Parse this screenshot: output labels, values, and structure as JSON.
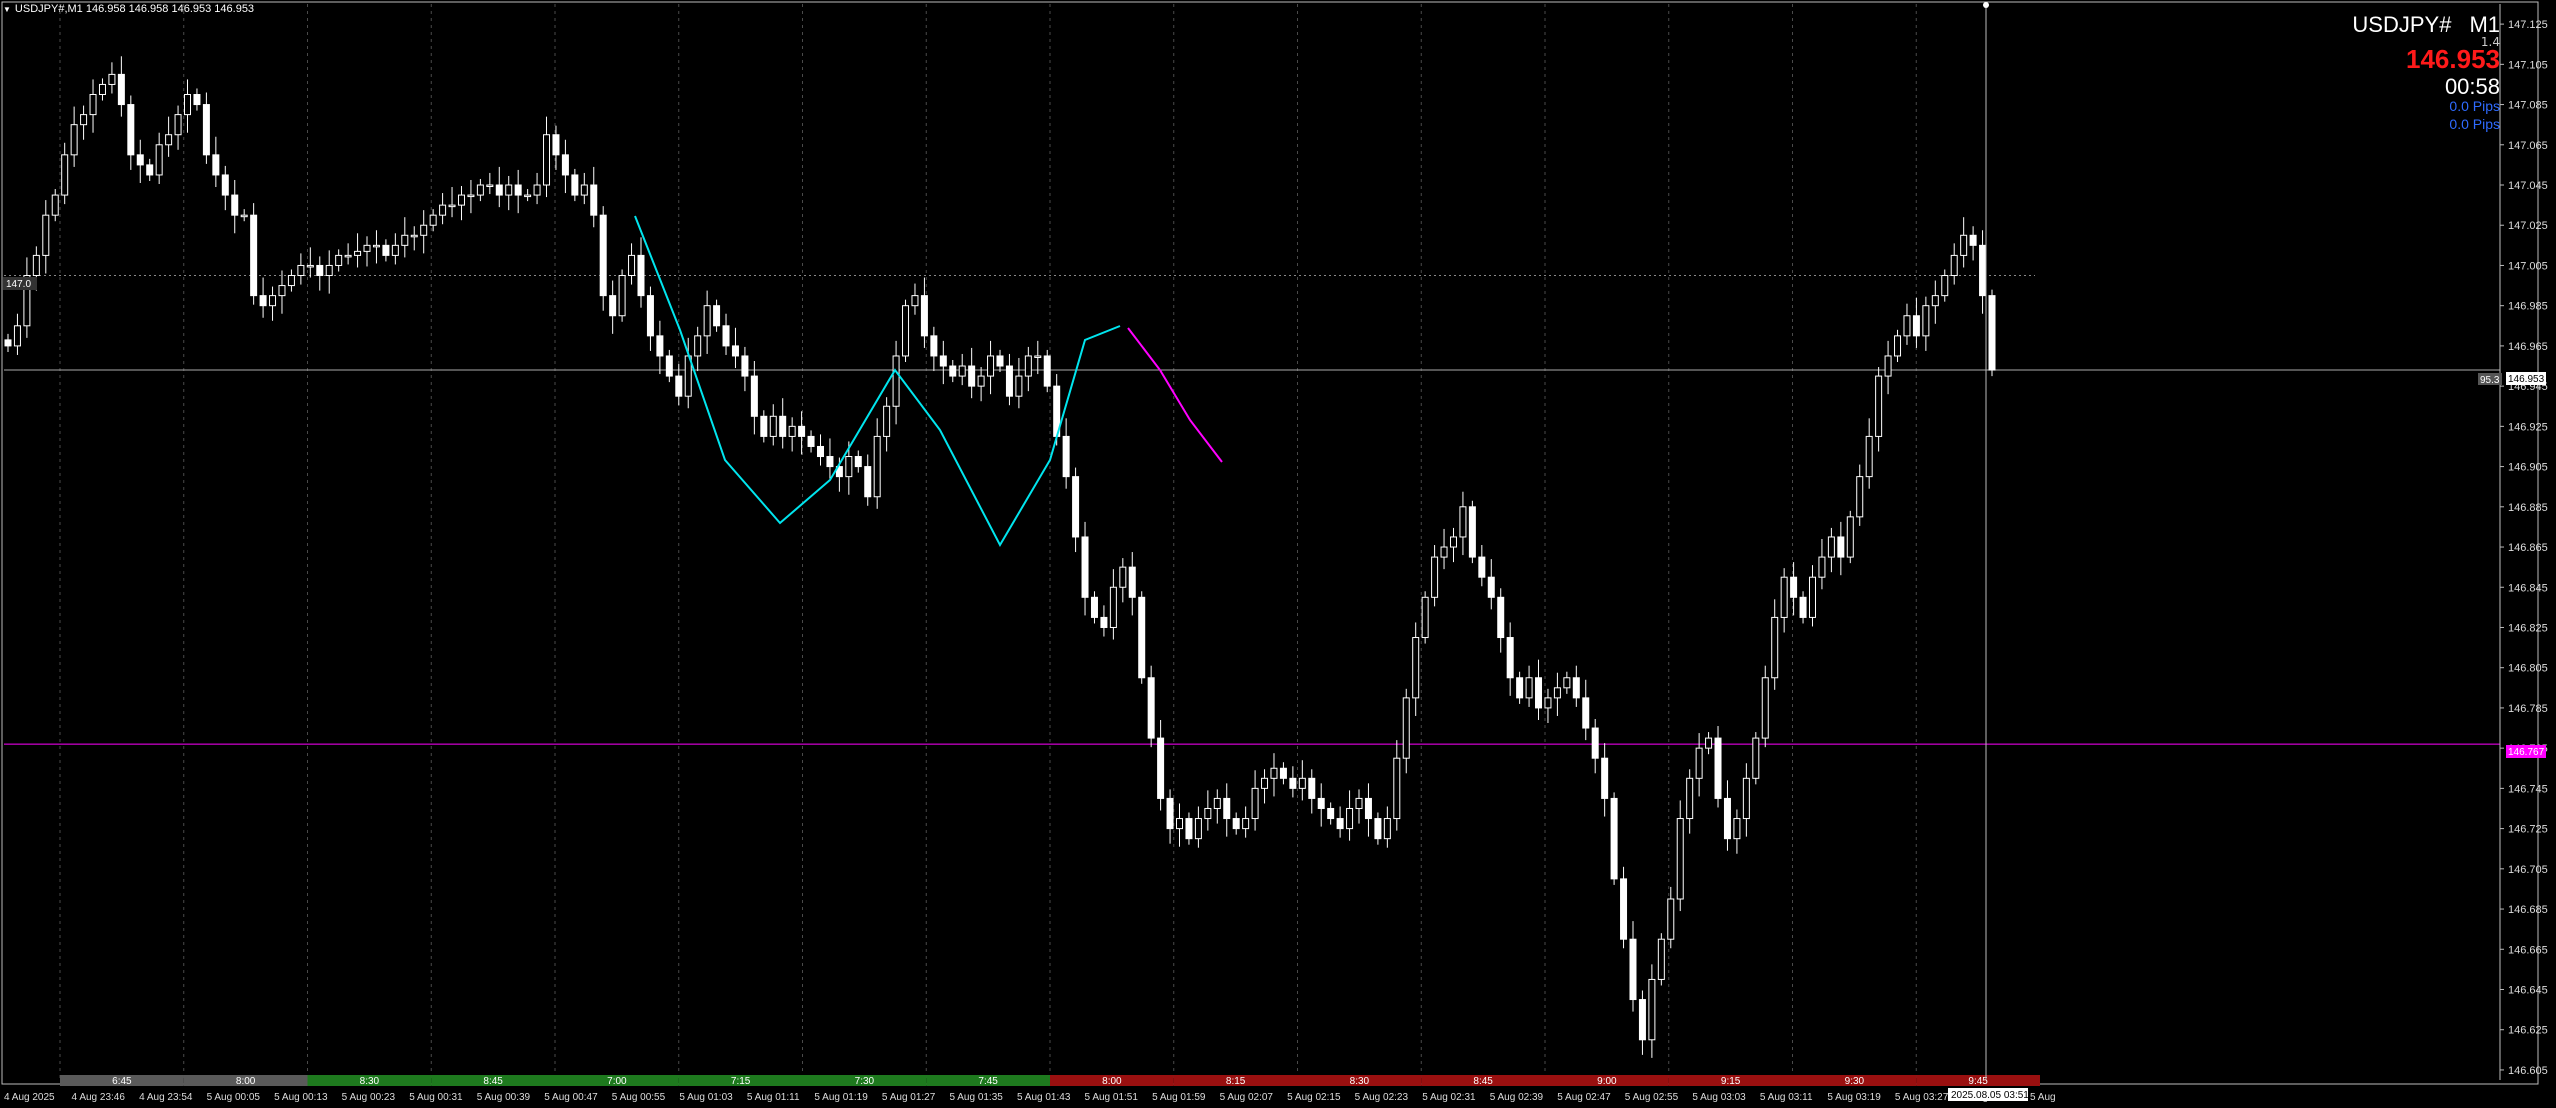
{
  "header": {
    "title": "USDJPY#,M1  146.958 146.958 146.953 146.953"
  },
  "hud": {
    "symbol": "USDJPY#",
    "timeframe": "M1",
    "spread": "1.4",
    "price": "146.953",
    "timer": "00:58",
    "pips_1": "0.0 Pips",
    "pips_2": "0.0 Pips"
  },
  "labels": {
    "level_147": "147.0",
    "current_price_box": "146.953",
    "magenta_price_box": "146.767",
    "cursor_time_box": "2025.08.05 03:51",
    "left_tag": "95.3"
  },
  "colors": {
    "background": "#000000",
    "candle": "#ffffff",
    "cyan_curve": "#00e5ee",
    "magenta_curve": "#ff00ff",
    "session_green": "#1e7a1e",
    "session_gray": "#5a5a5a",
    "session_red": "#9a1010",
    "grid": "#4a4a4a"
  },
  "chart_data": {
    "type": "candlestick",
    "y_ticks": [
      "147.125",
      "147.105",
      "147.085",
      "147.065",
      "147.045",
      "147.025",
      "147.005",
      "146.985",
      "146.965",
      "146.945",
      "146.925",
      "146.905",
      "146.885",
      "146.865",
      "146.845",
      "146.825",
      "146.805",
      "146.785",
      "146.765",
      "146.745",
      "146.725",
      "146.705",
      "146.685",
      "146.665",
      "146.645",
      "146.625",
      "146.605"
    ],
    "ylim": [
      146.6,
      147.135
    ],
    "x_ticks": [
      "4 Aug 2025",
      "4 Aug 23:46",
      "4 Aug 23:54",
      "5 Aug 00:05",
      "5 Aug 00:13",
      "5 Aug 00:23",
      "5 Aug 00:31",
      "5 Aug 00:39",
      "5 Aug 00:47",
      "5 Aug 00:55",
      "5 Aug 01:03",
      "5 Aug 01:11",
      "5 Aug 01:19",
      "5 Aug 01:27",
      "5 Aug 01:35",
      "5 Aug 01:43",
      "5 Aug 01:51",
      "5 Aug 01:59",
      "5 Aug 02:07",
      "5 Aug 02:15",
      "5 Aug 02:23",
      "5 Aug 02:31",
      "5 Aug 02:39",
      "5 Aug 02:47",
      "5 Aug 02:55",
      "5 Aug 03:03",
      "5 Aug 03:11",
      "5 Aug 03:19",
      "5 Aug 03:27",
      "5 Aug 03:35",
      "5 Aug"
    ],
    "session_labels": [
      "6:45",
      "8:00",
      "8:30",
      "8:45",
      "7:00",
      "7:15",
      "7:30",
      "7:45",
      "8:00",
      "8:15",
      "8:30",
      "8:45",
      "9:00",
      "9:15",
      "9:30",
      "9:45"
    ],
    "horizontal_lines": {
      "current_price": 146.953,
      "level_147": 147.0,
      "magenta_level": 146.767
    },
    "close_path": [
      146.965,
      146.975,
      147.0,
      147.01,
      147.03,
      147.04,
      147.06,
      147.075,
      147.08,
      147.09,
      147.095,
      147.1,
      147.085,
      147.06,
      147.055,
      147.05,
      147.065,
      147.07,
      147.08,
      147.09,
      147.085,
      147.06,
      147.05,
      147.04,
      147.03,
      147.03,
      146.99,
      146.985,
      146.99,
      146.995,
      147.0,
      147.005,
      147.005,
      147.0,
      147.005,
      147.01,
      147.01,
      147.012,
      147.015,
      147.015,
      147.01,
      147.015,
      147.02,
      147.02,
      147.025,
      147.03,
      147.035,
      147.035,
      147.04,
      147.04,
      147.045,
      147.045,
      147.04,
      147.045,
      147.04,
      147.04,
      147.045,
      147.07,
      147.06,
      147.05,
      147.04,
      147.045,
      147.03,
      146.99,
      146.98,
      147.0,
      147.01,
      146.99,
      146.97,
      146.96,
      146.95,
      146.94,
      146.96,
      146.97,
      146.985,
      146.975,
      146.965,
      146.96,
      146.95,
      146.93,
      146.92,
      146.93,
      146.92,
      146.925,
      146.92,
      146.915,
      146.91,
      146.905,
      146.9,
      146.91,
      146.905,
      146.89,
      146.92,
      146.935,
      146.96,
      146.985,
      146.99,
      146.97,
      146.96,
      146.955,
      146.95,
      146.955,
      146.945,
      146.95,
      146.96,
      146.955,
      146.94,
      146.95,
      146.96,
      146.96,
      146.945,
      146.92,
      146.9,
      146.87,
      146.84,
      146.83,
      146.825,
      146.845,
      146.855,
      146.84,
      146.8,
      146.77,
      146.74,
      146.725,
      146.73,
      146.72,
      146.73,
      146.735,
      146.74,
      146.73,
      146.725,
      146.73,
      146.745,
      146.75,
      146.755,
      146.75,
      146.745,
      146.75,
      146.74,
      146.735,
      146.73,
      146.725,
      146.735,
      146.74,
      146.73,
      146.72,
      146.73,
      146.76,
      146.79,
      146.82,
      146.84,
      146.86,
      146.865,
      146.87,
      146.885,
      146.86,
      146.85,
      146.84,
      146.82,
      146.8,
      146.79,
      146.8,
      146.785,
      146.79,
      146.795,
      146.8,
      146.79,
      146.775,
      146.76,
      146.74,
      146.7,
      146.67,
      146.64,
      146.62,
      146.65,
      146.67,
      146.69,
      146.73,
      146.75,
      146.765,
      146.77,
      146.74,
      146.72,
      146.73,
      146.75,
      146.77,
      146.8,
      146.83,
      146.85,
      146.84,
      146.83,
      146.85,
      146.86,
      146.87,
      146.86,
      146.88,
      146.9,
      146.92,
      146.95,
      146.96,
      146.97,
      146.98,
      146.97,
      146.985,
      146.99,
      147.0,
      147.01,
      147.02,
      147.015,
      146.99,
      146.953
    ],
    "cyan_curve_points": [
      [
        635,
        216
      ],
      [
        680,
        330
      ],
      [
        725,
        460
      ],
      [
        780,
        523
      ],
      [
        830,
        480
      ],
      [
        895,
        370
      ],
      [
        940,
        430
      ],
      [
        1000,
        545
      ],
      [
        1050,
        460
      ],
      [
        1085,
        340
      ],
      [
        1120,
        326
      ]
    ],
    "magenta_curve_points": [
      [
        1128,
        328
      ],
      [
        1160,
        370
      ],
      [
        1190,
        420
      ],
      [
        1222,
        462
      ]
    ]
  }
}
